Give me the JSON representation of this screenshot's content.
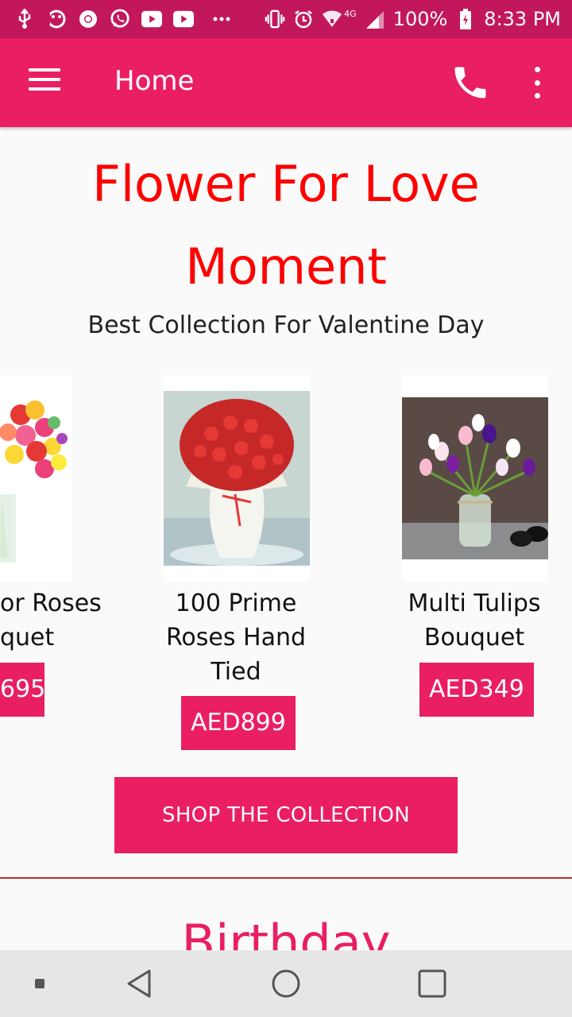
{
  "status_bar": {
    "battery": "100%",
    "time": "8:33 PM",
    "network": "4G"
  },
  "app_bar": {
    "title": "Home"
  },
  "hero": {
    "title_line1": "Flower For Love",
    "title_line2": "Moment",
    "subtitle": "Best Collection For Valentine Day"
  },
  "products": [
    {
      "name_line1": "or Roses",
      "name_line2": "quet",
      "price": "695"
    },
    {
      "name_line1": "100 Prime",
      "name_line2": "Roses Hand",
      "name_line3": "Tied",
      "price": "AED899"
    },
    {
      "name_line1": "Multi Tulips",
      "name_line2": "Bouquet",
      "price": "AED349"
    }
  ],
  "shop_button": "SHOP THE COLLECTION",
  "next_section_title": "Birthday",
  "colors": {
    "primary": "#e91e63",
    "status_bar": "#c2185b",
    "hero_red": "#ff0000"
  },
  "icons": [
    "usb-icon",
    "face-icon",
    "chrome-icon",
    "whatsapp-icon",
    "youtube-icon",
    "youtube-icon",
    "more-notifications-icon",
    "vibrate-icon",
    "alarm-icon",
    "wifi-icon",
    "signal-icon",
    "battery-icon",
    "menu-icon",
    "phone-icon",
    "more-vert-icon",
    "nav-square-small-icon",
    "nav-back-icon",
    "nav-home-icon",
    "nav-recents-icon"
  ]
}
